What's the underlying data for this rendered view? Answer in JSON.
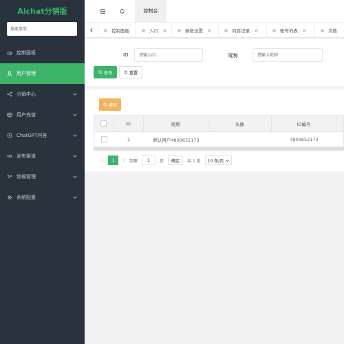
{
  "brand": {
    "title": "Aichat分销版"
  },
  "sidebar": {
    "search_placeholder": "搜索菜单",
    "items": [
      {
        "label": "控制面板",
        "icon": "dashboard-icon",
        "active": false,
        "expandable": false
      },
      {
        "label": "用户管理",
        "icon": "user-icon",
        "active": true,
        "expandable": false
      },
      {
        "label": "分销中心",
        "icon": "share-icon",
        "active": false,
        "expandable": true
      },
      {
        "label": "用户充值",
        "icon": "box-icon",
        "active": false,
        "expandable": true
      },
      {
        "label": "ChatGPT问答",
        "icon": "chat-icon",
        "active": false,
        "expandable": true
      },
      {
        "label": "发布渠道",
        "icon": "link-icon",
        "active": false,
        "expandable": true
      },
      {
        "label": "常规管理",
        "icon": "tools-icon",
        "active": false,
        "expandable": true
      },
      {
        "label": "系统配置",
        "icon": "gear-icon",
        "active": false,
        "expandable": true
      }
    ]
  },
  "header": {
    "current": "控制台"
  },
  "tabs": [
    {
      "label": "控制面板",
      "closable": false
    },
    {
      "label": "入口",
      "closable": true
    },
    {
      "label": "参数设置",
      "closable": true
    },
    {
      "label": "问答记录",
      "closable": true
    },
    {
      "label": "账号列表",
      "closable": true
    },
    {
      "label": "次数",
      "closable": false
    }
  ],
  "filter": {
    "id_label": "ID",
    "id_placeholder": "请输入ID",
    "nickname_label": "昵称",
    "nickname_placeholder": "请输入昵称",
    "query_button": "查询",
    "reset_button": "重置"
  },
  "table": {
    "search_button": "搜索",
    "columns": [
      "ID",
      "昵称",
      "头像",
      "ID编号"
    ],
    "rows": [
      {
        "id": "1",
        "nickname": "默认用户4809652173",
        "avatar": "",
        "id_number": "4809652173"
      }
    ]
  },
  "pagination": {
    "current_page": "1",
    "goto_label": "到第",
    "page_input": "1",
    "page_suffix": "页",
    "confirm": "确定",
    "total": "共 1 条",
    "page_size": "10 条/页"
  },
  "colors": {
    "sidebar_bg": "#28333e",
    "accent": "#3cb56a",
    "search_btn": "#f6b35e"
  }
}
